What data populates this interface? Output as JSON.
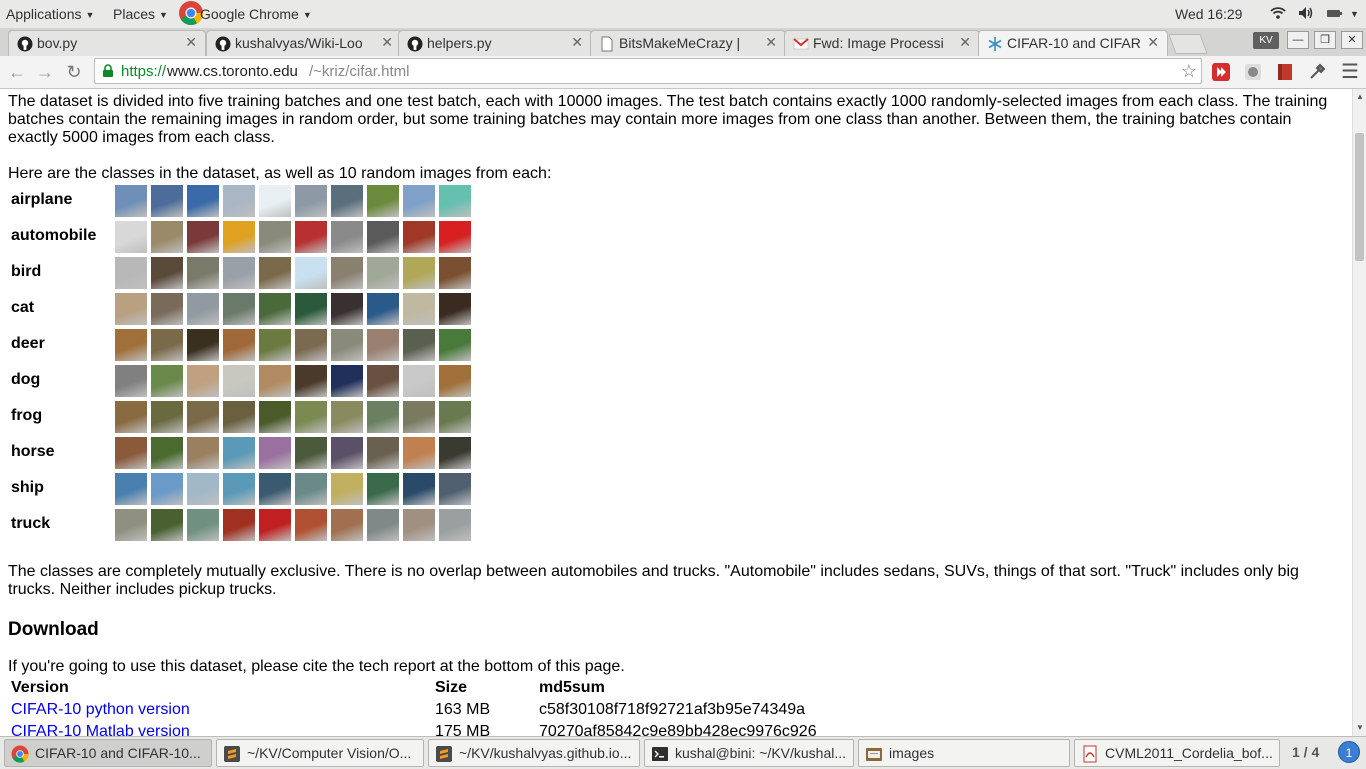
{
  "topbar": {
    "applications": "Applications",
    "places": "Places",
    "active_app": "Google Chrome",
    "clock": "Wed 16:29"
  },
  "tabs": [
    {
      "title": "bov.py",
      "icon": "github-icon"
    },
    {
      "title": "kushalvyas/Wiki-Loo",
      "icon": "github-icon"
    },
    {
      "title": "helpers.py",
      "icon": "github-icon"
    },
    {
      "title": "BitsMakeMeCrazy |",
      "icon": "page-icon"
    },
    {
      "title": "Fwd: Image Processi",
      "icon": "gmail-icon"
    },
    {
      "title": "CIFAR-10 and CIFAR",
      "icon": "snowflake-icon"
    }
  ],
  "profile_badge": "KV",
  "url": {
    "scheme": "https://",
    "host": "www.cs.toronto.edu",
    "path": "/~kriz/cifar.html"
  },
  "page": {
    "intro": "The dataset is divided into five training batches and one test batch, each with 10000 images. The test batch contains exactly 1000 randomly-selected images from each class. The training batches contain the remaining images in random order, but some training batches may contain more images from one class than another. Between them, the training batches contain exactly 5000 images from each class.",
    "classes_intro": "Here are the classes in the dataset, as well as 10 random images from each:",
    "classes": [
      {
        "label": "airplane",
        "colors": [
          "#6e8fb8",
          "#4d6c9a",
          "#3a6aa8",
          "#a9b6c4",
          "#e8f0f4",
          "#8d9aa6",
          "#5a6f7c",
          "#6c8a3c",
          "#7fa0c8",
          "#66c0b0"
        ]
      },
      {
        "label": "automobile",
        "colors": [
          "#d8d8d8",
          "#9a8a6a",
          "#7a3a3a",
          "#e0a020",
          "#8a8a7a",
          "#b83030",
          "#8a8a8a",
          "#5a5a5a",
          "#a03828",
          "#d82020"
        ]
      },
      {
        "label": "bird",
        "colors": [
          "#b8b8b8",
          "#5a4a3a",
          "#7a7a6a",
          "#9aa0a8",
          "#7a6a4a",
          "#c8e0f0",
          "#8a8070",
          "#a0a898",
          "#b0a858",
          "#7a5030"
        ]
      },
      {
        "label": "cat",
        "colors": [
          "#b8a080",
          "#7a6a5a",
          "#909aa0",
          "#6a7a6a",
          "#4a6a3a",
          "#2a5a3a",
          "#3a3030",
          "#2a5a8a",
          "#c0b8a0",
          "#3a2a20"
        ]
      },
      {
        "label": "deer",
        "colors": [
          "#a0703a",
          "#7a6a4a",
          "#3a3020",
          "#a06838",
          "#6a7a40",
          "#7a6a50",
          "#8a8a7a",
          "#9a8070",
          "#5a6050",
          "#4a7a3a"
        ]
      },
      {
        "label": "dog",
        "colors": [
          "#808080",
          "#6a8a4a",
          "#c0a080",
          "#c8c8c0",
          "#b08a60",
          "#4a3a2a",
          "#20305a",
          "#6a5040",
          "#c8c8c8",
          "#a07038"
        ]
      },
      {
        "label": "frog",
        "colors": [
          "#8a6a40",
          "#6a6a40",
          "#7a6a48",
          "#6a6040",
          "#4a5a28",
          "#7a8a50",
          "#8a8a60",
          "#6a8060",
          "#7a7a60",
          "#6a7a50"
        ]
      },
      {
        "label": "horse",
        "colors": [
          "#8a5a3a",
          "#4a6a30",
          "#9a8060",
          "#5a9ab8",
          "#9a70a0",
          "#4a5a3a",
          "#5a5068",
          "#6a6050",
          "#c08050",
          "#3a3a30"
        ]
      },
      {
        "label": "ship",
        "colors": [
          "#4a80b0",
          "#6a9ac8",
          "#a0b8c8",
          "#5a9ab8",
          "#3a5a70",
          "#6a8a8a",
          "#c0b060",
          "#3a6a4a",
          "#2a4a6a",
          "#506070"
        ]
      },
      {
        "label": "truck",
        "colors": [
          "#909080",
          "#4a6030",
          "#709080",
          "#a03020",
          "#c02020",
          "#b05030",
          "#a07050",
          "#808888",
          "#a09080",
          "#9aa0a0"
        ]
      }
    ],
    "exclusive_text": "The classes are completely mutually exclusive. There is no overlap between automobiles and trucks. \"Automobile\" includes sedans, SUVs, things of that sort. \"Truck\" includes only big trucks. Neither includes pickup trucks.",
    "download_heading": "Download",
    "cite_text": "If you're going to use this dataset, please cite the tech report at the bottom of this page.",
    "table": {
      "headers": [
        "Version",
        "Size",
        "md5sum"
      ],
      "rows": [
        [
          "CIFAR-10 python version",
          "163 MB",
          "c58f30108f718f92721af3b95e74349a"
        ],
        [
          "CIFAR-10 Matlab version",
          "175 MB",
          "70270af85842c9e89bb428ec9976c926"
        ]
      ]
    }
  },
  "taskbar": {
    "items": [
      {
        "label": "CIFAR-10 and CIFAR-10...",
        "icon": "chrome-icon"
      },
      {
        "label": "~/KV/Computer Vision/O...",
        "icon": "sublime-icon"
      },
      {
        "label": "~/KV/kushalvyas.github.io...",
        "icon": "sublime-icon"
      },
      {
        "label": "kushal@bini: ~/KV/kushal...",
        "icon": "terminal-icon"
      },
      {
        "label": "images",
        "icon": "folder-icon"
      },
      {
        "label": "CVML2011_Cordelia_bof...",
        "icon": "pdf-icon"
      }
    ],
    "workspace": "1 / 4",
    "notifications": "1"
  }
}
